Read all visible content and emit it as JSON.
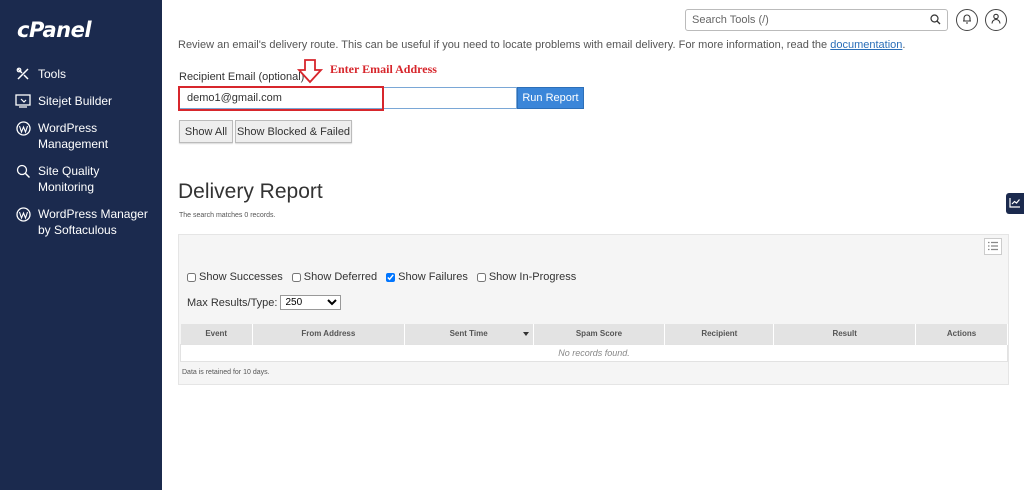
{
  "brand": {
    "logo": "cPanel"
  },
  "sidebar": {
    "items": [
      {
        "label": "Tools",
        "icon": "tools-icon"
      },
      {
        "label": "Sitejet Builder",
        "icon": "sitejet-icon"
      },
      {
        "label": "WordPress Management",
        "icon": "wordpress-icon"
      },
      {
        "label": "Site Quality Monitoring",
        "icon": "magnifier-icon"
      },
      {
        "label": "WordPress Manager by Softaculous",
        "icon": "wordpress-icon"
      }
    ]
  },
  "header": {
    "search_placeholder": "Search Tools (/)"
  },
  "page": {
    "intro": "Review an email's delivery route. This can be useful if you need to locate problems with email delivery. For more information, read the",
    "intro_link": "documentation",
    "intro_end": ".",
    "recipient_label": "Recipient Email (optional)",
    "recipient_value": "demo1@gmail.com",
    "annotation": "Enter Email Address",
    "run_report": "Run Report",
    "show_all": "Show All",
    "show_blocked": "Show Blocked & Failed",
    "report_title": "Delivery Report",
    "report_count": "The search matches 0 records.",
    "filters": [
      {
        "label": "Show Successes",
        "checked": false
      },
      {
        "label": "Show Deferred",
        "checked": false
      },
      {
        "label": "Show Failures",
        "checked": true
      },
      {
        "label": "Show In-Progress",
        "checked": false
      }
    ],
    "max_results_label": "Max Results/Type:",
    "max_results_value": "250",
    "table": {
      "columns": [
        "Event",
        "From Address",
        "Sent Time",
        "Spam Score",
        "Recipient",
        "Result",
        "Actions"
      ],
      "empty": "No records found."
    },
    "retention": "Data is retained for 10 days."
  },
  "colors": {
    "sidebar_bg": "#1b2a4e",
    "primary": "#3b86d9",
    "annotation": "#d7262c"
  }
}
